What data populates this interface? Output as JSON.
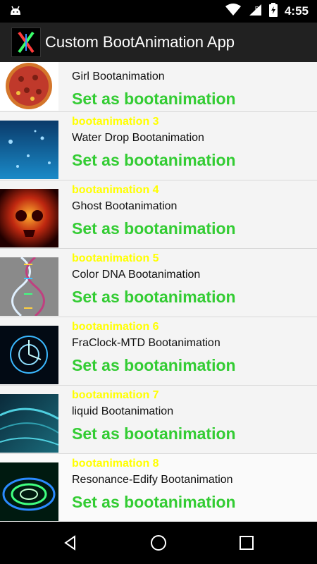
{
  "statusbar": {
    "time": "4:55"
  },
  "appbar": {
    "title": "Custom BootAnimation App",
    "logo_text": "X"
  },
  "items": [
    {
      "number": "",
      "name": "Girl Bootanimation",
      "action": "Set as bootanimation",
      "thumb": "pizza-image"
    },
    {
      "number": "bootanimation 3",
      "name": "Water Drop Bootanimation",
      "action": "Set as bootanimation",
      "thumb": "water-drop-image"
    },
    {
      "number": "bootanimation 4",
      "name": "Ghost Bootanimation",
      "action": "Set as bootanimation",
      "thumb": "ghost-skull-image"
    },
    {
      "number": "bootanimation 5",
      "name": "Color DNA Bootanimation",
      "action": "Set as bootanimation",
      "thumb": "dna-helix-image"
    },
    {
      "number": "bootanimation 6",
      "name": "FraClock-MTD Bootanimation",
      "action": "Set as bootanimation",
      "thumb": "fractal-clock-image"
    },
    {
      "number": "bootanimation 7",
      "name": "liquid Bootanimation",
      "action": "Set as bootanimation",
      "thumb": "liquid-android-image"
    },
    {
      "number": "bootanimation 8",
      "name": "Resonance-Edify Bootanimation",
      "action": "Set as bootanimation",
      "thumb": "resonance-ripple-image"
    }
  ],
  "colors": {
    "number": "#ffff00",
    "action": "#33cc33",
    "appbar": "#212121"
  }
}
